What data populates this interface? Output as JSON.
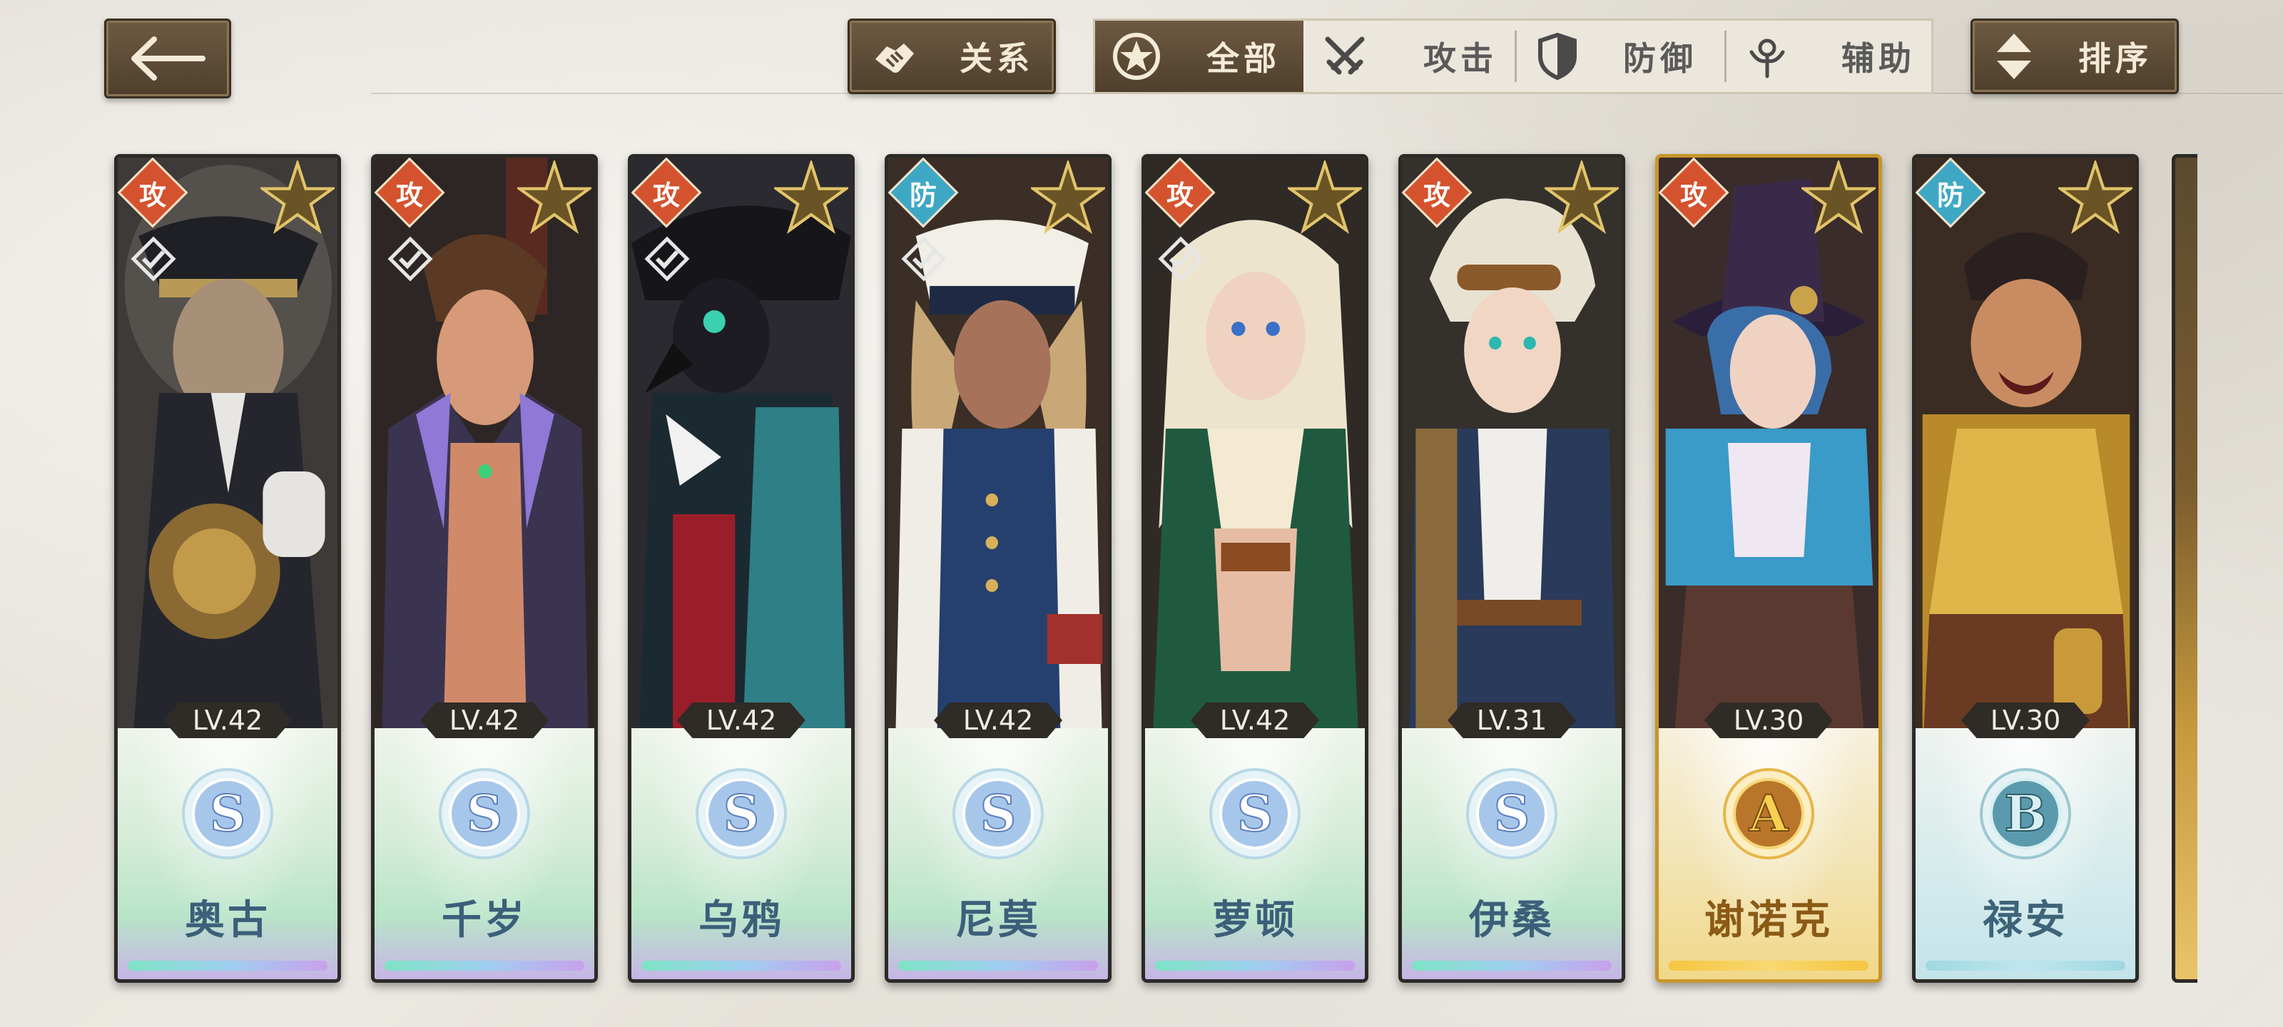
{
  "header": {
    "relation_label": "关系",
    "sort_label": "排序",
    "filters": [
      {
        "label": "全部",
        "icon": "star-circle-icon",
        "active": true
      },
      {
        "label": "攻击",
        "icon": "crossed-swords-icon",
        "active": false
      },
      {
        "label": "防御",
        "icon": "shield-icon",
        "active": false
      },
      {
        "label": "辅助",
        "icon": "support-emblem-icon",
        "active": false
      }
    ]
  },
  "colors": {
    "attack_role": "#d4532e",
    "defense_role": "#3ea8c4",
    "button_brown": "#5b4a35"
  },
  "characters": [
    {
      "name": "奥古",
      "level": "LV.42",
      "rank": "S",
      "role": "攻",
      "selected": true
    },
    {
      "name": "千岁",
      "level": "LV.42",
      "rank": "S",
      "role": "攻",
      "selected": true
    },
    {
      "name": "乌鸦",
      "level": "LV.42",
      "rank": "S",
      "role": "攻",
      "selected": true
    },
    {
      "name": "尼莫",
      "level": "LV.42",
      "rank": "S",
      "role": "防",
      "selected": true
    },
    {
      "name": "萝顿",
      "level": "LV.42",
      "rank": "S",
      "role": "攻",
      "selected": true
    },
    {
      "name": "伊桑",
      "level": "LV.31",
      "rank": "S",
      "role": "攻",
      "selected": false
    },
    {
      "name": "谢诺克",
      "level": "LV.30",
      "rank": "A",
      "role": "攻",
      "selected": false
    },
    {
      "name": "禄安",
      "level": "LV.30",
      "rank": "B",
      "role": "防",
      "selected": false
    }
  ]
}
